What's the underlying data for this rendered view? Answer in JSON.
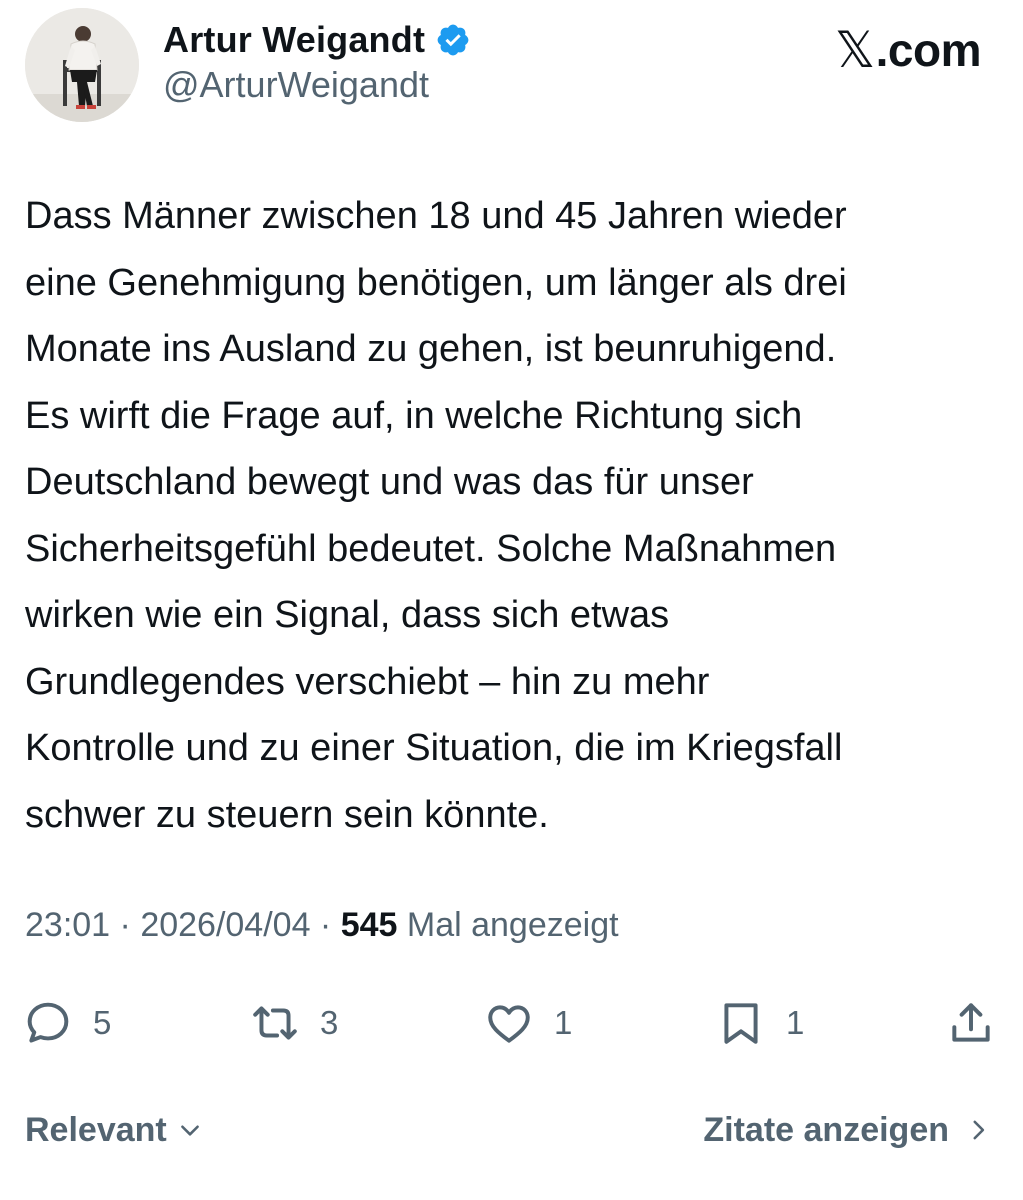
{
  "author": {
    "display_name": "Artur Weigandt",
    "handle": "@ArturWeigandt",
    "verified": true,
    "verified_color": "#1d9bf0"
  },
  "brand": {
    "glyph": "𝕏",
    "suffix": ".com"
  },
  "tweet": {
    "text": "Dass Männer zwischen 18 und 45 Jahren wieder\neine Genehmigung benötigen, um länger als drei\nMonate ins Ausland zu gehen, ist beunruhigend.\nEs wirft die Frage auf, in welche Richtung sich\nDeutschland bewegt und was das für unser\nSicherheitsgefühl bedeutet. Solche Maßnahmen\nwirken wie ein Signal, dass sich etwas\nGrundlegendes verschiebt – hin zu mehr\nKontrolle und zu einer Situation, die im Kriegsfall\nschwer zu steuern sein könnte."
  },
  "meta": {
    "time": "23:01",
    "separator": " · ",
    "date": "2026/04/04",
    "views_count": "545",
    "views_label": " Mal angezeigt"
  },
  "actions": {
    "replies": "5",
    "reposts": "3",
    "likes": "1",
    "bookmarks": "1"
  },
  "icons": {
    "reply": "reply-icon",
    "repost": "repost-icon",
    "like": "heart-icon",
    "bookmark": "bookmark-icon",
    "share": "share-icon",
    "verified": "verified-badge-icon",
    "sort": "chevron-down-icon",
    "quotes": "chevron-right-icon"
  },
  "footer": {
    "sort_label": "Relevant",
    "quotes_label": "Zitate anzeigen"
  },
  "colors": {
    "text_primary": "#0f1419",
    "text_secondary": "#536471",
    "background": "#ffffff"
  }
}
